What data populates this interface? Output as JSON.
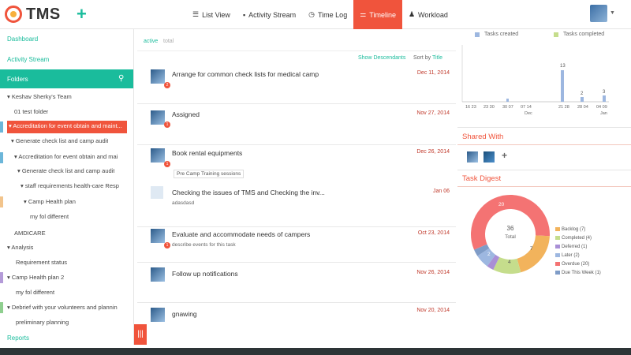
{
  "app": {
    "logo_text": "TMS",
    "add_label": "+"
  },
  "nav": {
    "items": [
      {
        "label": "List View",
        "icon": "list-icon",
        "glyph": "☰"
      },
      {
        "label": "Activity Stream",
        "icon": "comment-icon",
        "glyph": "▪"
      },
      {
        "label": "Time Log",
        "icon": "clock-icon",
        "glyph": "◷"
      },
      {
        "label": "Timeline",
        "icon": "timeline-icon",
        "glyph": "⚌",
        "active": true
      },
      {
        "label": "Workload",
        "icon": "user-icon",
        "glyph": "♟"
      }
    ]
  },
  "sidebar": {
    "dashboard": "Dashboard",
    "activity_stream": "Activity Stream",
    "folders": "Folders",
    "search_glyph": "⚲",
    "tree": [
      {
        "label": "▾ Keshav Sherky's Team"
      },
      {
        "label": "01 test folder"
      },
      {
        "label": "▾ Accreditation for event obtain and maint...",
        "selected": true
      },
      {
        "label": "▾ Generate check list and camp audit"
      },
      {
        "label": "▾ Accreditation for event obtain and mai"
      },
      {
        "label": "▾ Generate check list and camp audit"
      },
      {
        "label": "▾ staff requirements health-care Resp"
      },
      {
        "label": "▾ Camp Health plan"
      },
      {
        "label": "my fol different"
      },
      {
        "label": "AMDICARE"
      },
      {
        "label": "▾ Analysis"
      },
      {
        "label": "Requirement status"
      },
      {
        "label": "▾ Camp Health plan 2"
      },
      {
        "label": "my fol different"
      },
      {
        "label": "▾ Debrief with your volunteers and plannin"
      },
      {
        "label": "preliminary planning"
      }
    ],
    "reports": "Reports",
    "toggle_glyph": "|||"
  },
  "filters": {
    "active": "active",
    "total": "total",
    "show_descendants": "Show Descendants",
    "sort_prefix": "Sort by",
    "sort_value": "Title"
  },
  "tasks": [
    {
      "title": "Arrange for common check lists for medical camp",
      "date": "Dec 11, 2014",
      "badge": "2"
    },
    {
      "title": "Assigned",
      "date": "Nov 27, 2014",
      "badge": "1"
    },
    {
      "title": "Book rental equipments",
      "date": "Dec 26, 2014",
      "badge": "1",
      "tag": "Pre Camp Training sessions"
    },
    {
      "title": "Checking the issues of TMS and Checking the inv...",
      "date": "Jan 06",
      "sub": "adasdasd"
    },
    {
      "title": "Evaluate and accommodate needs of campers",
      "date": "Oct 23, 2014",
      "badge": "1",
      "sub": "describe events for this task"
    },
    {
      "title": "Follow up notifications",
      "date": "Nov 26, 2014"
    },
    {
      "title": "gnawing",
      "date": "Nov 20, 2014"
    }
  ],
  "colors": {
    "accent": "#f0543c",
    "teal": "#1abc9c",
    "created": "#9db7e0",
    "completed": "#c5dd8c"
  },
  "bar_chart": {
    "legend": [
      "Tasks created",
      "Tasks completed"
    ],
    "x_labels": [
      "16 23",
      "23 30",
      "30 07",
      "07 14",
      "21 28",
      "28 04",
      "04 09"
    ],
    "x_sub": {
      "dec": "Dec",
      "jan": "Jan"
    },
    "labels": [
      "13",
      "2",
      "3"
    ]
  },
  "shared": {
    "title": "Shared With",
    "add": "+"
  },
  "digest": {
    "title": "Task Digest",
    "center_value": "36",
    "center_label": "Total",
    "slices": [
      {
        "label": "Backlog (7)",
        "value": 7,
        "color": "#f2b35c"
      },
      {
        "label": "Completed (4)",
        "value": 4,
        "color": "#c5dd8c"
      },
      {
        "label": "Deferred (1)",
        "value": 1,
        "color": "#a98fd6"
      },
      {
        "label": "Later (2)",
        "value": 2,
        "color": "#9db7e0"
      },
      {
        "label": "Overdue (20)",
        "value": 20,
        "color": "#f47373"
      },
      {
        "label": "Due This Week (1)",
        "value": 1,
        "color": "#7f9cc7"
      }
    ],
    "slice_numbers": [
      "20",
      "2",
      "4",
      "7"
    ]
  }
}
